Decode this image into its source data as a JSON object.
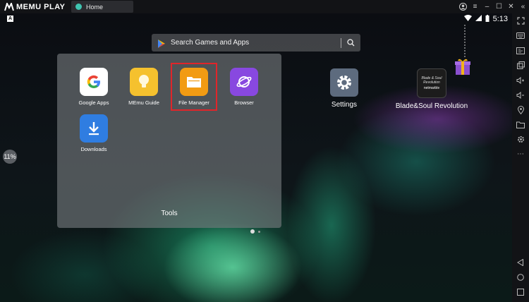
{
  "window": {
    "logo_text": "MEMU PLAY",
    "tab_label": "Home"
  },
  "status": {
    "a_badge": "A",
    "time": "5:13"
  },
  "search": {
    "placeholder": "Search Games and Apps"
  },
  "folder": {
    "title": "Tools",
    "apps": [
      {
        "label": "Google Apps",
        "icon": "google-icon",
        "bg": "#ffffff"
      },
      {
        "label": "MEmu Guide",
        "icon": "lightbulb-icon",
        "bg": "#f5c12e"
      },
      {
        "label": "File Manager",
        "icon": "folder-icon",
        "bg": "#f29b13"
      },
      {
        "label": "Browser",
        "icon": "planet-icon",
        "bg": "#8848e0"
      },
      {
        "label": "Downloads",
        "icon": "download-icon",
        "bg": "#2f7de1"
      }
    ]
  },
  "desktop": {
    "settings_label": "Settings",
    "game_label": "Blade&Soul Revolution",
    "game_icon_text": "Blade & Soul Revolution",
    "game_icon_brand": "netmarble"
  },
  "side_badge": "11%",
  "colors": {
    "highlight": "#e0252a",
    "accent": "#3fc4b0"
  }
}
